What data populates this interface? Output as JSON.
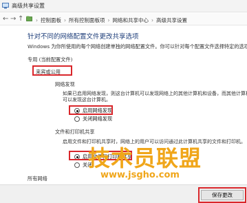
{
  "window": {
    "title": "高级共享设置"
  },
  "nav": {
    "back": "←",
    "forward": "→",
    "up": "↑",
    "breadcrumbs": [
      "控制面板",
      "所有控制面板项",
      "网络和共享中心",
      "高级共享设置"
    ],
    "separator": "›"
  },
  "page": {
    "title": "针对不同的网络配置文件更改共享选项",
    "description": "Windows 为你所使用的每个网络创建单独的网络配置文件。你可以针对每个配置文件选择特定的选项。"
  },
  "profiles": {
    "private_label": "专用 (当前配置文件)",
    "guest_public_label": "来宾或公用",
    "network_discovery": {
      "heading": "网络发现",
      "description_line1": "如果已启用网络发现，则这台计算机可以发现网络上的其他计算机和设备，而其他计算机",
      "description_line2": "可以发现这台计算机。",
      "options": [
        {
          "label": "启用网络发现",
          "selected": true
        },
        {
          "label": "关闭网络发现",
          "selected": false
        }
      ]
    },
    "file_printer_sharing": {
      "heading": "文件和打印机共享",
      "description": "启用文件和打印机共享时，网络上的用户可以访问通过此计算机共享的文件和打印机。",
      "options": [
        {
          "label": "启用文件和打印机共享",
          "selected": true
        },
        {
          "label": "关闭",
          "selected": false
        }
      ]
    },
    "all_networks_label": "所有网络"
  },
  "footer": {
    "save_label": "保存更改"
  },
  "watermark": {
    "text": "技术员联盟",
    "url": "www.jsgho.com"
  },
  "colors": {
    "highlight": "#d9262b",
    "title_blue": "#1e3e7a",
    "watermark": "#f0a61a"
  }
}
